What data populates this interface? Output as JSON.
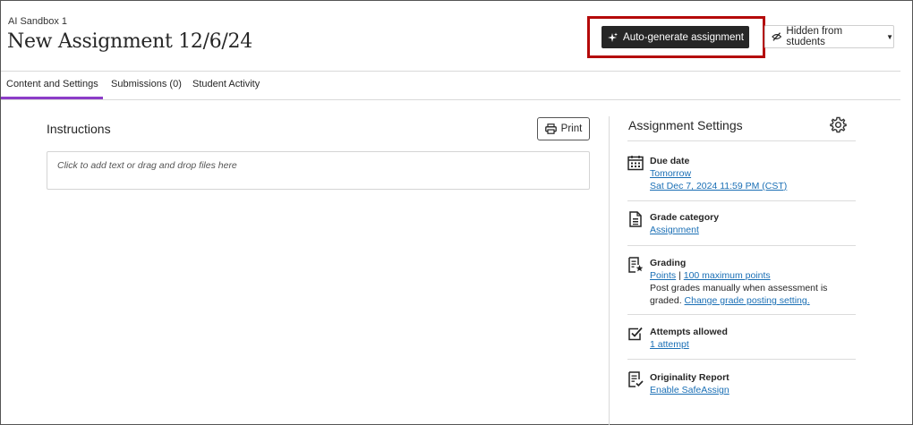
{
  "header": {
    "course_name": "AI Sandbox 1",
    "title": "New Assignment 12/6/24",
    "auto_generate_label": "Auto-generate assignment",
    "visibility_label": "Hidden from students"
  },
  "tabs": [
    {
      "label": "Content and Settings",
      "active": true
    },
    {
      "label": "Submissions (0)",
      "active": false
    },
    {
      "label": "Student Activity",
      "active": false
    }
  ],
  "instructions": {
    "title": "Instructions",
    "print_label": "Print",
    "editor_placeholder": "Click to add text or drag and drop files here"
  },
  "settings": {
    "title": "Assignment Settings",
    "due_date": {
      "label": "Due date",
      "link1": "Tomorrow",
      "link2": "Sat Dec 7, 2024 11:59 PM (CST)"
    },
    "grade_category": {
      "label": "Grade category",
      "link": "Assignment"
    },
    "grading": {
      "label": "Grading",
      "link1": "Points",
      "separator": " | ",
      "link2": "100 maximum points",
      "text": "Post grades manually when assessment is graded. ",
      "link3": "Change grade posting setting."
    },
    "attempts": {
      "label": "Attempts allowed",
      "link": "1 attempt"
    },
    "originality": {
      "label": "Originality Report",
      "link": "Enable SafeAssign"
    }
  },
  "colors": {
    "accent_tab": "#8c3cc8",
    "highlight_box": "#b40a0a",
    "link": "#1a6fb5",
    "dark_button": "#262626"
  }
}
